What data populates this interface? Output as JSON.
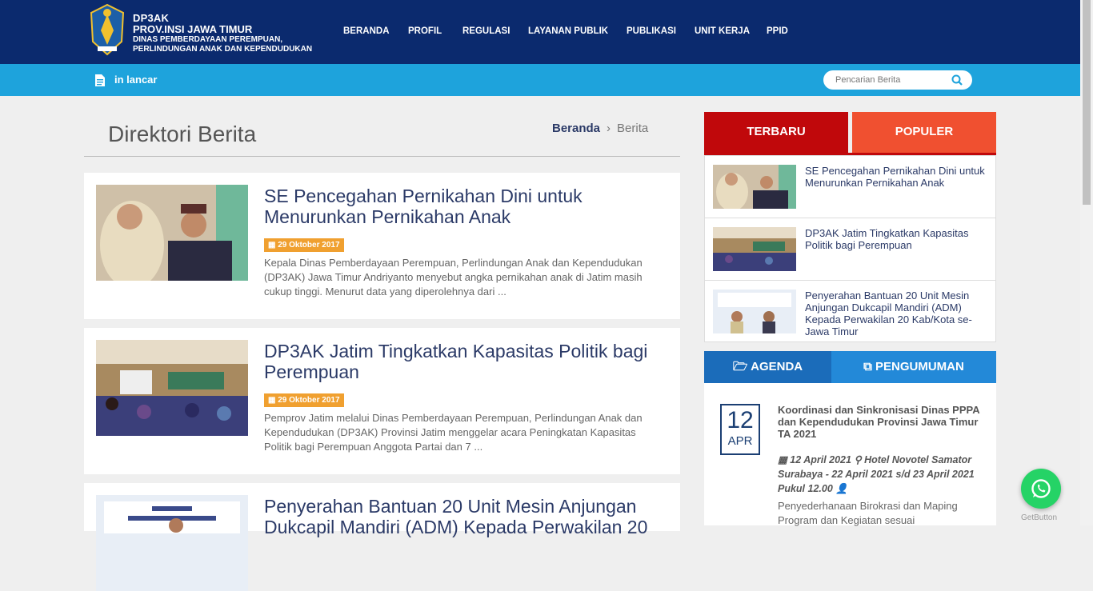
{
  "header": {
    "logo_line1": "DP3AK",
    "logo_line2": "PROV.INSI JAWA TIMUR",
    "logo_line3": "DINAS PEMBERDAYAAN PEREMPUAN, PERLINDUNGAN ANAK DAN KEPENDUDUKAN",
    "nav": [
      "BERANDA",
      "PROFIL",
      "REGULASI",
      "LAYANAN PUBLIK",
      "PUBLIKASI",
      "UNIT KERJA",
      "PPID"
    ]
  },
  "subbar": {
    "ticker_text": "in lancar",
    "search_placeholder": "Pencarian Berita"
  },
  "main": {
    "page_title": "Direktori Berita",
    "breadcrumb": {
      "home": "Beranda",
      "sep": "›",
      "current": "Berita"
    },
    "articles": [
      {
        "title": "SE Pencegahan Pernikahan Dini untuk Menurunkan Pernikahan Anak",
        "date": "29 Oktober 2017",
        "excerpt": "Kepala Dinas Pemberdayaan Perempuan, Perlindungan Anak dan Kependudukan (DP3AK) Jawa Timur Andriyanto menyebut angka pernikahan anak di Jatim masih cukup tinggi. Menurut data yang diperolehnya dari ..."
      },
      {
        "title": "DP3AK Jatim Tingkatkan Kapasitas Politik bagi Perempuan",
        "date": "29 Oktober 2017",
        "excerpt": "Pemprov Jatim melalui Dinas Pemberdayaan Perempuan, Perlindungan Anak dan Kependudukan (DP3AK) Provinsi Jatim menggelar acara Peningkatan Kapasitas Politik bagi Perempuan Anggota Partai dan 7 ..."
      },
      {
        "title": "Penyerahan Bantuan 20 Unit Mesin Anjungan Dukcapil Mandiri (ADM) Kepada Perwakilan 20",
        "date": "",
        "excerpt": ""
      }
    ]
  },
  "sidebar": {
    "tab_latest": "TERBARU",
    "tab_popular": "POPULER",
    "latest": [
      {
        "title": "SE Pencegahan Pernikahan Dini untuk Menurunkan Pernikahan Anak"
      },
      {
        "title": "DP3AK Jatim Tingkatkan Kapasitas Politik bagi Perempuan"
      },
      {
        "title": "Penyerahan Bantuan 20 Unit Mesin Anjungan Dukcapil Mandiri (ADM) Kepada Perwakilan 20 Kab/Kota se-Jawa Timur"
      }
    ],
    "tab_agenda": "AGENDA",
    "tab_announcement": "PENGUMUMAN",
    "agenda": {
      "day": "12",
      "month": "APR",
      "title": "Koordinasi dan Sinkronisasi Dinas PPPA dan Kependudukan Provinsi Jawa Timur TA 2021",
      "date_text": "12 April 2021",
      "location": "Hotel Novotel Samator Surabaya - 22 April 2021 s/d 23 April 2021 Pukul 12.00",
      "description": "Penyederhanaan Birokrasi dan Maping Program dan Kegiatan sesuai"
    }
  },
  "widget": {
    "label": "GetButton"
  },
  "colors": {
    "header": "#0b2a6e",
    "subbar": "#1ea3dc",
    "tab_red": "#c0080b",
    "tab_orange": "#f05030",
    "tab_blue": "#1b6cba",
    "date_badge": "#f0a030",
    "whatsapp": "#25d366"
  }
}
